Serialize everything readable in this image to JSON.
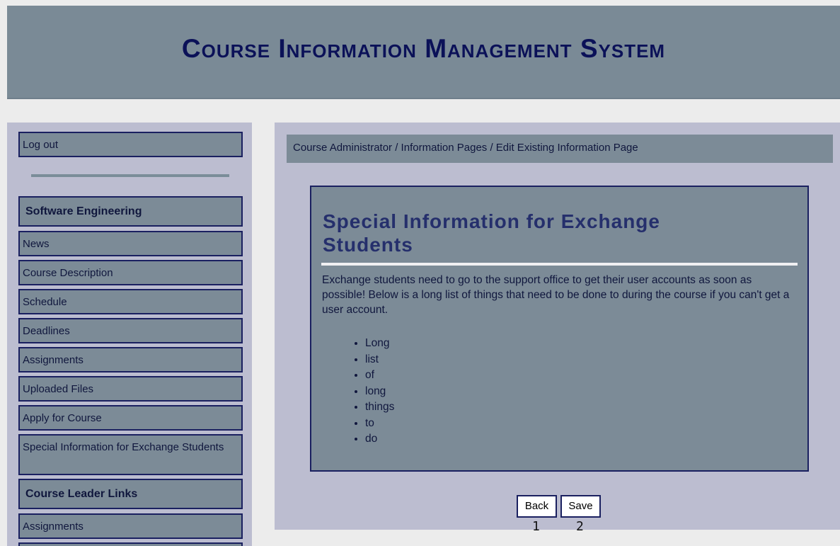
{
  "header": {
    "title": "Course Information Management System"
  },
  "sidebar": {
    "logout_label": "Log out",
    "section1_title": "Software Engineering",
    "items": [
      {
        "label": "News"
      },
      {
        "label": "Course Description"
      },
      {
        "label": "Schedule"
      },
      {
        "label": "Deadlines"
      },
      {
        "label": "Assignments"
      },
      {
        "label": "Uploaded Files"
      },
      {
        "label": "Apply for Course"
      },
      {
        "label": "Special Information for Exchange Students"
      }
    ],
    "section2_title": "Course Leader Links",
    "leader_items": [
      {
        "label": "Assignments"
      }
    ]
  },
  "main": {
    "breadcrumb": "Course Administrator / Information Pages / Edit Existing Information Page",
    "page_title": "Special Information for Exchange Students",
    "body_text": "Exchange students need to go to the support office to get their user accounts as soon as possible! Below is a long list of things that need to be done to during the course if you can't get a user account.",
    "list": [
      "Long",
      "list",
      "of",
      "long",
      "things",
      "to",
      "do"
    ],
    "back_label": "Back",
    "save_label": "Save"
  },
  "annotations": {
    "marker1": "1",
    "marker2": "2"
  },
  "colors": {
    "header_bg": "#7a8a96",
    "panel_bg": "#bcbdd0",
    "item_bg": "#7c8b97",
    "title_text": "#0b1158",
    "border": "#1a2060"
  }
}
